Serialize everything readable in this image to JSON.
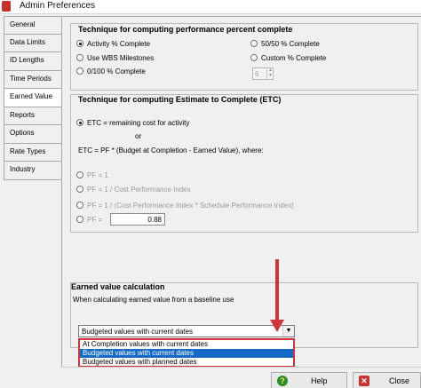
{
  "window": {
    "title": "Admin Preferences"
  },
  "tabs": [
    {
      "label": "General"
    },
    {
      "label": "Data Limits"
    },
    {
      "label": "ID Lengths"
    },
    {
      "label": "Time Periods"
    },
    {
      "label": "Earned Value"
    },
    {
      "label": "Reports"
    },
    {
      "label": "Options"
    },
    {
      "label": "Rate Types"
    },
    {
      "label": "Industry"
    }
  ],
  "active_tab": "Earned Value",
  "percent_complete": {
    "title": "Technique for computing performance percent complete",
    "options": {
      "activity": "Activity % Complete",
      "fifty": "50/50 % Complete",
      "wbs": "Use WBS Milestones",
      "custom": "Custom % Complete",
      "zero_hundred": "0/100 % Complete"
    },
    "selected": "activity",
    "spin_value": "6"
  },
  "etc": {
    "title": "Technique for computing Estimate to Complete (ETC)",
    "options": {
      "remaining": "ETC = remaining cost for activity",
      "or": "or",
      "formula": "ETC = PF * (Budget at Completion - Earned Value), where:",
      "pf1": "PF = 1",
      "pf_cpi": "PF = 1 / Cost Performance Index",
      "pf_cpi_spi": "PF = 1 / (Cost Performance Index * Schedule Performance Index)",
      "pf_custom": "PF ="
    },
    "selected": "remaining",
    "pf_value": "0.88"
  },
  "ev_calc": {
    "title": "Earned value calculation",
    "description": "When calculating earned value from a baseline use",
    "selected_value": "Budgeted values with current dates",
    "options": [
      {
        "label": "At Completion values with current dates"
      },
      {
        "label": "Budgeted values with current dates"
      },
      {
        "label": "Budgeted values with planned dates"
      }
    ],
    "highlighted_option": "Budgeted values with current dates"
  },
  "buttons": {
    "help": "Help",
    "close": "Close"
  },
  "colors": {
    "annotation": "#d0343a",
    "highlight": "#1569c7"
  }
}
